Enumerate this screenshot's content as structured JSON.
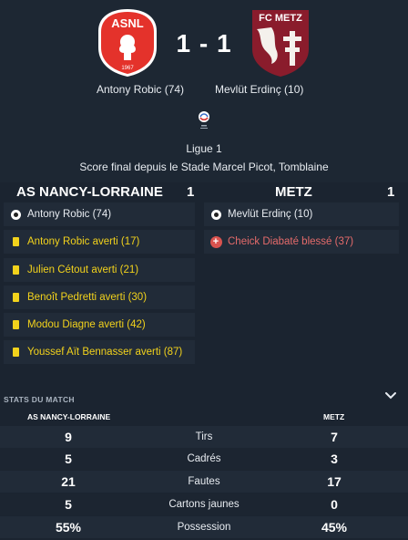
{
  "match": {
    "home_badge_text": "ASNL",
    "home_badge_year": "1967",
    "away_badge_text": "FC METZ",
    "score": "1 - 1",
    "home_scorer": "Antony Robic (74)",
    "away_scorer": "Mevlüt Erdinç (10)",
    "league": "Ligue 1",
    "venue": "Score final depuis le Stade Marcel Picot, Tomblaine"
  },
  "teams": {
    "home_name": "AS NANCY-LORRAINE",
    "home_score": "1",
    "away_name": "METZ",
    "away_score": "1"
  },
  "home_events": [
    {
      "type": "goal",
      "text": "Antony Robic (74)"
    },
    {
      "type": "yellow",
      "text": "Antony Robic averti (17)"
    },
    {
      "type": "yellow",
      "text": "Julien Cétout averti (21)"
    },
    {
      "type": "yellow",
      "text": "Benoît Pedretti averti (30)"
    },
    {
      "type": "yellow",
      "text": "Modou Diagne averti (42)"
    },
    {
      "type": "yellow",
      "text": "Youssef Aït Bennasser averti (87)"
    }
  ],
  "away_events": [
    {
      "type": "goal",
      "text": "Mevlüt Erdinç (10)"
    },
    {
      "type": "injury",
      "text": "Cheick Diabaté blessé (37)"
    }
  ],
  "stats": {
    "title": "STATS DU MATCH",
    "home_header": "AS NANCY-LORRAINE",
    "away_header": "METZ",
    "rows": [
      {
        "home": "9",
        "label": "Tirs",
        "away": "7"
      },
      {
        "home": "5",
        "label": "Cadrés",
        "away": "3"
      },
      {
        "home": "21",
        "label": "Fautes",
        "away": "17"
      },
      {
        "home": "5",
        "label": "Cartons jaunes",
        "away": "0"
      },
      {
        "home": "55%",
        "label": "Possession",
        "away": "45%"
      }
    ]
  },
  "colors": {
    "background": "#1b2430",
    "row": "#212b38",
    "yellow_card": "#f2d21c",
    "injury": "#d9534f",
    "home_red": "#e4322b",
    "away_maroon": "#8a1c2c"
  },
  "icons": {
    "goal": "football-icon",
    "yellow": "yellow-card-icon",
    "injury": "injury-icon",
    "collapse": "chevron-down-icon"
  }
}
